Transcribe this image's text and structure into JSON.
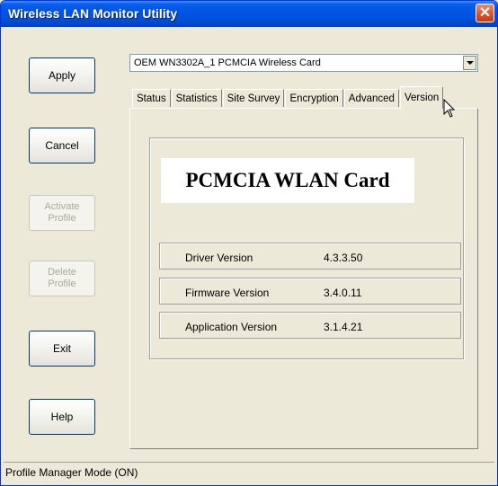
{
  "window": {
    "title": "Wireless LAN Monitor Utility",
    "close_glyph": "✕"
  },
  "buttons": {
    "apply": "Apply",
    "cancel": "Cancel",
    "activate_profile": [
      "Activate",
      "Profile"
    ],
    "delete_profile": [
      "Delete",
      "Profile"
    ],
    "exit": "Exit",
    "help": "Help"
  },
  "adapter": {
    "selected": "OEM WN3302A_1 PCMCIA Wireless Card"
  },
  "tabs": [
    "Status",
    "Statistics",
    "Site Survey",
    "Encryption",
    "Advanced",
    "Version"
  ],
  "active_tab": "Version",
  "version": {
    "card_name": "PCMCIA WLAN Card",
    "rows": [
      {
        "label": "Driver Version",
        "value": "4.3.3.50"
      },
      {
        "label": "Firmware Version",
        "value": "3.4.0.11"
      },
      {
        "label": "Application Version",
        "value": "3.1.4.21"
      }
    ]
  },
  "status_bar": {
    "text": "Profile Manager Mode (ON)"
  },
  "icons": {
    "cursor": "mouse-pointer-icon",
    "dropdown": "chevron-down-icon"
  }
}
